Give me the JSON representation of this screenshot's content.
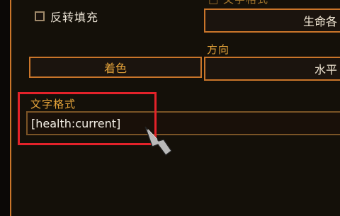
{
  "checkbox": {
    "label": "反转填充",
    "checked": false
  },
  "health_select": {
    "value": "生命各"
  },
  "color_button": {
    "label": "着色"
  },
  "direction": {
    "label": "方向",
    "value": "水平"
  },
  "text_format": {
    "label": "文字格式",
    "value": "[health:current]"
  },
  "colors": {
    "accent": "#c9752a",
    "label": "#e6a43a",
    "highlight": "#e3222a"
  }
}
